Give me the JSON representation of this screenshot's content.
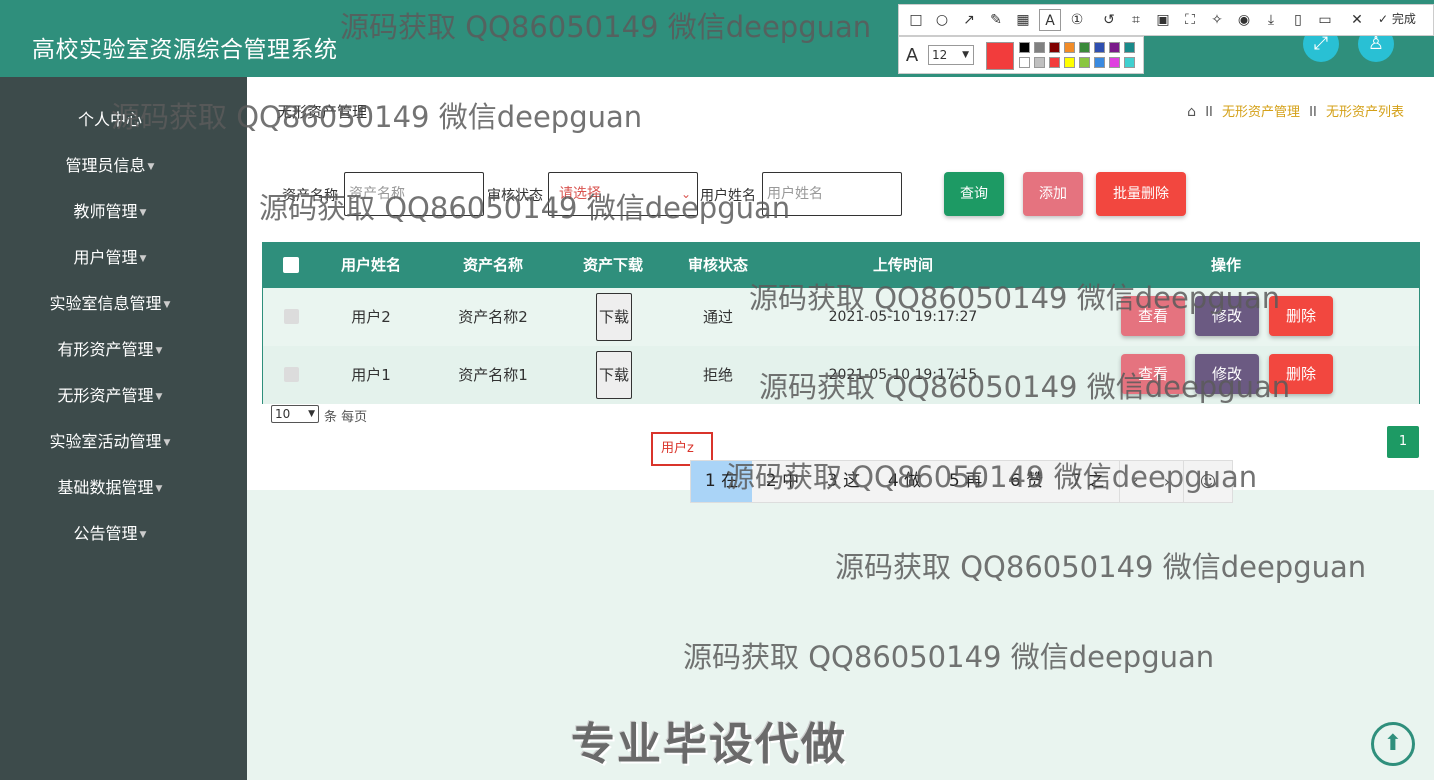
{
  "app": {
    "title": "高校实验室资源综合管理系统"
  },
  "header_buttons": [
    {
      "name": "fullscreen-button",
      "icon": "expand-icon",
      "glyph": "⤢"
    },
    {
      "name": "profile-button",
      "icon": "user-icon",
      "glyph": "♙"
    }
  ],
  "sidebar": {
    "items": [
      {
        "label": "个人中心",
        "has_caret": false
      },
      {
        "label": "管理员信息",
        "has_caret": true
      },
      {
        "label": "教师管理",
        "has_caret": true
      },
      {
        "label": "用户管理",
        "has_caret": true
      },
      {
        "label": "实验室信息管理",
        "has_caret": true
      },
      {
        "label": "有形资产管理",
        "has_caret": true
      },
      {
        "label": "无形资产管理",
        "has_caret": true
      },
      {
        "label": "实验室活动管理",
        "has_caret": true
      },
      {
        "label": "基础数据管理",
        "has_caret": true
      },
      {
        "label": "公告管理",
        "has_caret": true
      }
    ]
  },
  "breadcrumb": {
    "page_title": "无形资产管理",
    "home_icon": "home-icon",
    "path": [
      "无形资产管理",
      "无形资产列表"
    ],
    "separator": "II"
  },
  "filters": {
    "asset_name_label": "资产名称",
    "asset_name_placeholder": "资产名称",
    "status_label": "审核状态",
    "status_value": "请选择",
    "username_label": "用户姓名",
    "username_placeholder": "用户姓名"
  },
  "buttons": {
    "query": "查询",
    "add": "添加",
    "batch_delete": "批量删除"
  },
  "table": {
    "columns": [
      "用户姓名",
      "资产名称",
      "资产下载",
      "审核状态",
      "上传时间",
      "操作"
    ],
    "rows": [
      {
        "username": "用户2",
        "asset": "资产名称2",
        "download": "下载",
        "status": "通过",
        "time": "2021-05-10 19:17:27"
      },
      {
        "username": "用户1",
        "asset": "资产名称1",
        "download": "下载",
        "status": "拒绝",
        "time": "2021-05-10 19:17:15"
      }
    ],
    "actions": {
      "view": "查看",
      "edit": "修改",
      "delete": "删除"
    }
  },
  "pagination": {
    "page_size": "10",
    "page_size_label": "条 每页",
    "current_page": "1"
  },
  "ime": {
    "composition": "用户z",
    "candidates": [
      "1 在",
      "2 中",
      "3 这",
      "4 做",
      "5 再",
      "6 赞",
      "7 之"
    ],
    "prev_icon": "chevron-left-icon",
    "next_icon": "chevron-right-icon",
    "emoji_icon": "smile-icon"
  },
  "annotation_toolbar": {
    "tools": [
      "rectangle-icon",
      "ellipse-icon",
      "arrow-icon",
      "pen-icon",
      "mosaic-icon",
      "text-icon",
      "number-icon",
      "undo-icon",
      "crop-icon",
      "pin-icon",
      "ocr-icon",
      "magic-icon",
      "record-icon",
      "download-icon",
      "save-icon",
      "bookmark-icon",
      "close-icon"
    ],
    "done_label": "完成",
    "font_size": "12",
    "current_color": "#f23c3c",
    "swatches": [
      "#000000",
      "#808080",
      "#800000",
      "#f28c28",
      "#3a8a3a",
      "#2f4fb0",
      "#7a1a8a",
      "#1a8a8a",
      "#ffffff",
      "#c0c0c0",
      "#f23c3c",
      "#ffff00",
      "#8ac640",
      "#3a8ae0",
      "#e040e0",
      "#40d0d0"
    ]
  },
  "watermarks": {
    "text": "源码获取 QQ86050149 微信deepguan",
    "slogan": "专业毕设代做"
  },
  "colors": {
    "primary": "#2f8f7c",
    "sidebar": "#3d4b4b",
    "accent_gold": "#d4a017"
  }
}
